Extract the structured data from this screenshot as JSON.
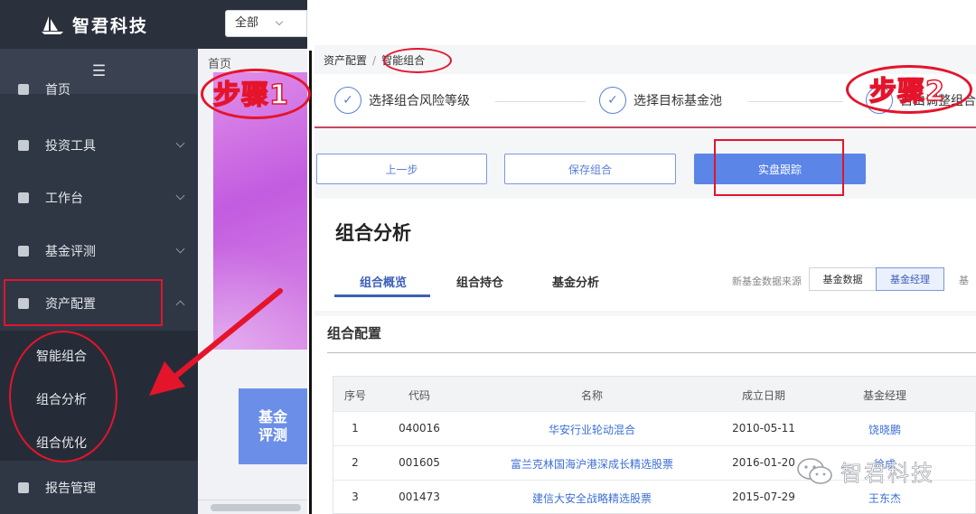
{
  "left": {
    "logo": "智君科技",
    "filter_select": "全部",
    "breadcrumb_home": "首页",
    "menu": [
      {
        "label": "首页"
      },
      {
        "label": "投资工具"
      },
      {
        "label": "工作台"
      },
      {
        "label": "基金评测"
      },
      {
        "label": "资产配置"
      },
      {
        "label": "报告管理"
      }
    ],
    "submenu": [
      "智能组合",
      "组合分析",
      "组合优化"
    ],
    "fund_tile": "基金\n评测"
  },
  "right": {
    "breadcrumb": [
      "资产配置",
      "智能组合"
    ],
    "steps": [
      "选择组合风险等级",
      "选择目标基金池",
      "自由调整组合"
    ],
    "buttons": {
      "prev": "上一步",
      "save": "保存组合",
      "track": "实盘跟踪"
    },
    "panel_title": "组合分析",
    "tabs": [
      "组合概览",
      "组合持仓",
      "基金分析"
    ],
    "data_source_label": "新基金数据来源",
    "data_source_options": [
      "基金数据",
      "基金经理"
    ],
    "data_source_tail": "基",
    "section_title": "组合配置",
    "table": {
      "headers": [
        "序号",
        "代码",
        "名称",
        "成立日期",
        "基金经理"
      ],
      "rows": [
        [
          "1",
          "040016",
          "华安行业轮动混合",
          "2010-05-11",
          "饶晓鹏"
        ],
        [
          "2",
          "001605",
          "富兰克林国海沪港深成长精选股票",
          "2016-01-20",
          "徐成"
        ],
        [
          "3",
          "001473",
          "建信大安全战略精选股票",
          "2015-07-29",
          "王东杰"
        ]
      ]
    }
  },
  "annotations": {
    "step1": "步骤1",
    "step2": "步骤2",
    "color": "#e4142b"
  },
  "watermark": "智君科技"
}
